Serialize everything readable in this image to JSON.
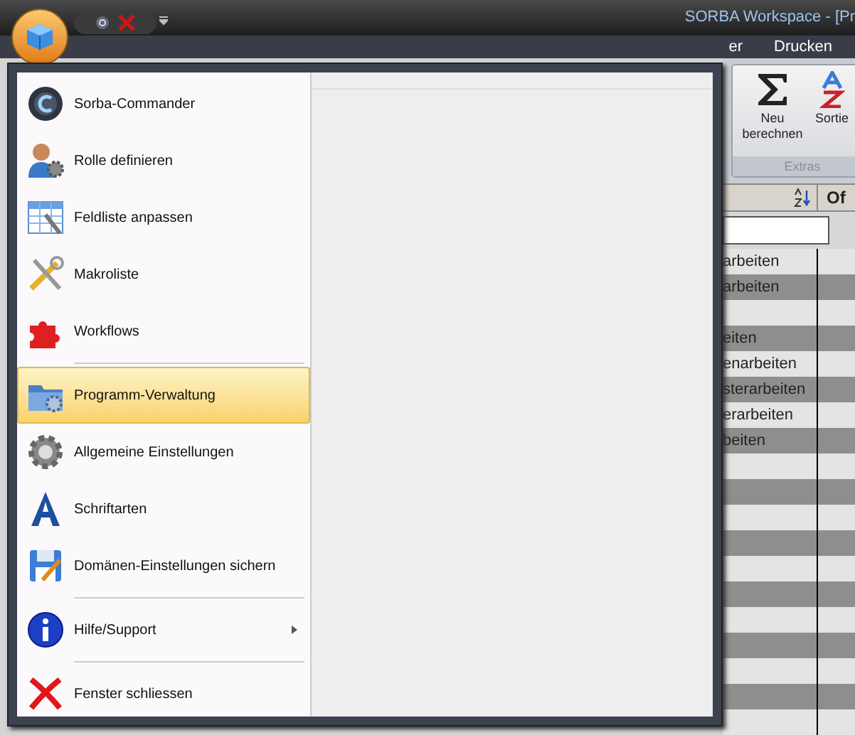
{
  "window": {
    "title": "SORBA Workspace - [Pr"
  },
  "ribbon": {
    "tabs": [
      {
        "label": "er",
        "selected": false
      },
      {
        "label": "Drucken",
        "selected": false
      }
    ],
    "group": {
      "label": "Extras",
      "buttons": [
        {
          "label": "Neu berechnen",
          "kind": "sum"
        },
        {
          "label": "Sortie",
          "kind": "sort"
        }
      ]
    }
  },
  "grid": {
    "column_2_header": "Of",
    "rows": [
      {
        "column_1": "arbeiten"
      },
      {
        "column_1": "arbeiten"
      },
      {
        "column_1": ""
      },
      {
        "column_1": "eiten"
      },
      {
        "column_1": "enarbeiten"
      },
      {
        "column_1": "sterarbeiten"
      },
      {
        "column_1": "erarbeiten"
      },
      {
        "column_1": "beiten"
      },
      {
        "column_1": ""
      },
      {
        "column_1": ""
      },
      {
        "column_1": ""
      },
      {
        "column_1": ""
      },
      {
        "column_1": ""
      },
      {
        "column_1": ""
      },
      {
        "column_1": ""
      },
      {
        "column_1": ""
      },
      {
        "column_1": ""
      },
      {
        "column_1": ""
      },
      {
        "column_1": ""
      }
    ]
  },
  "app_menu": {
    "items": [
      {
        "label": "Sorba-Commander",
        "kind": "commander",
        "selected": false
      },
      {
        "label": "Rolle definieren",
        "kind": "role",
        "selected": false
      },
      {
        "label": "Feldliste anpassen",
        "kind": "fieldlist",
        "selected": false
      },
      {
        "label": "Makroliste",
        "kind": "tools",
        "selected": false
      },
      {
        "label": "Workflows",
        "kind": "puzzle",
        "selected": false,
        "separator_after": true
      },
      {
        "label": "Programm-Verwaltung",
        "kind": "folder",
        "selected": true
      },
      {
        "label": "Allgemeine Einstellungen",
        "kind": "gear",
        "selected": false
      },
      {
        "label": "Schriftarten",
        "kind": "font",
        "selected": false
      },
      {
        "label": "Domänen-Einstellungen sichern",
        "kind": "save",
        "selected": false,
        "separator_after": true
      },
      {
        "label": "Hilfe/Support",
        "kind": "info",
        "selected": false,
        "submenu": true,
        "separator_after": true
      },
      {
        "label": "Fenster schliessen",
        "kind": "close",
        "selected": false
      }
    ]
  }
}
